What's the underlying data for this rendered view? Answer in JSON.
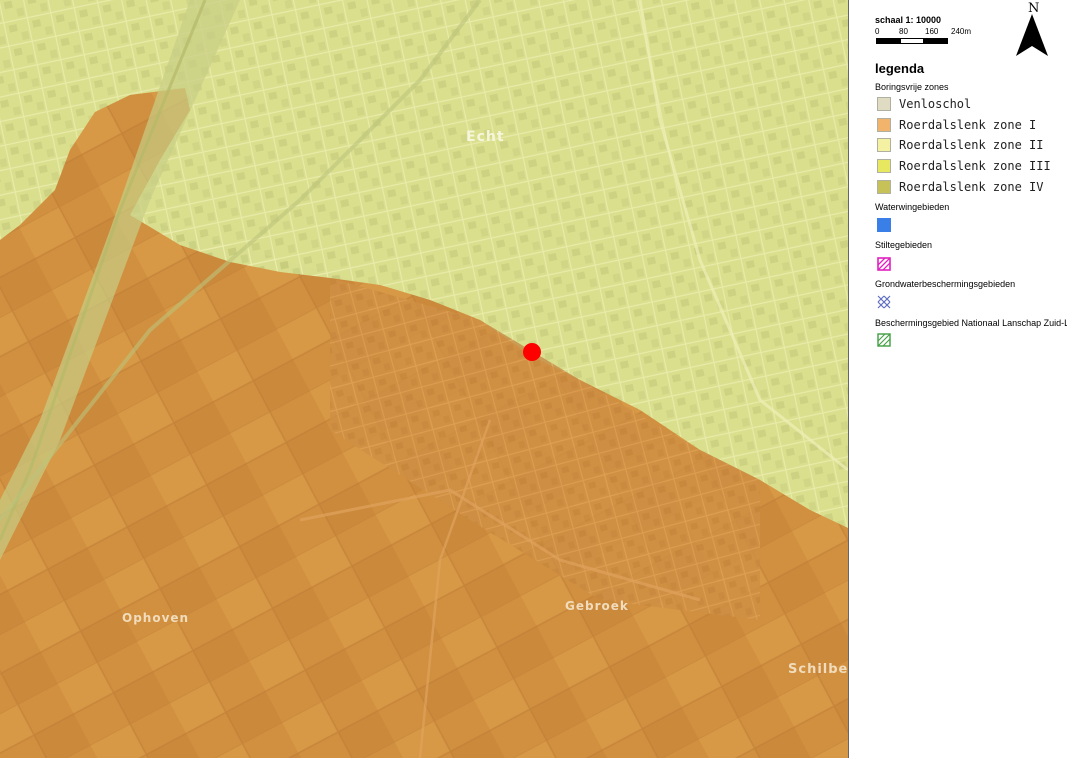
{
  "map": {
    "place_labels": [
      {
        "name": "Echt"
      },
      {
        "name": "Ophoven"
      },
      {
        "name": "Gebroek"
      },
      {
        "name": "Schilberg"
      }
    ],
    "marker": {
      "color": "#ff0000"
    }
  },
  "legend": {
    "scale": {
      "title": "schaal 1: 10000",
      "ticks": [
        "0",
        "80",
        "160",
        "240m"
      ]
    },
    "north_label": "N",
    "title": "legenda",
    "groups": [
      {
        "title": "Boringsvrije zones",
        "items": [
          {
            "label": "Venloschol",
            "color": "#e0dcc4"
          },
          {
            "label": "Roerdalslenk zone I",
            "color": "#f2b36d"
          },
          {
            "label": "Roerdalslenk zone II",
            "color": "#f4f2a2"
          },
          {
            "label": "Roerdalslenk zone III",
            "color": "#e8e860"
          },
          {
            "label": "Roerdalslenk zone IV",
            "color": "#c6c258"
          }
        ]
      },
      {
        "title": "Waterwingebieden",
        "symbol": "solid-blue-square",
        "color": "#3a7ee8"
      },
      {
        "title": "Stiltegebieden",
        "symbol": "pink-hatched-square",
        "color": "#e020c0"
      },
      {
        "title": "Grondwaterbeschermingsgebieden",
        "symbol": "blue-cross-hatch",
        "color": "#6070c0"
      },
      {
        "title": "Beschermingsgebied Nationaal Lanschap Zuid-Limburg",
        "symbol": "green-hatched-square",
        "color": "#40a040"
      }
    ]
  }
}
